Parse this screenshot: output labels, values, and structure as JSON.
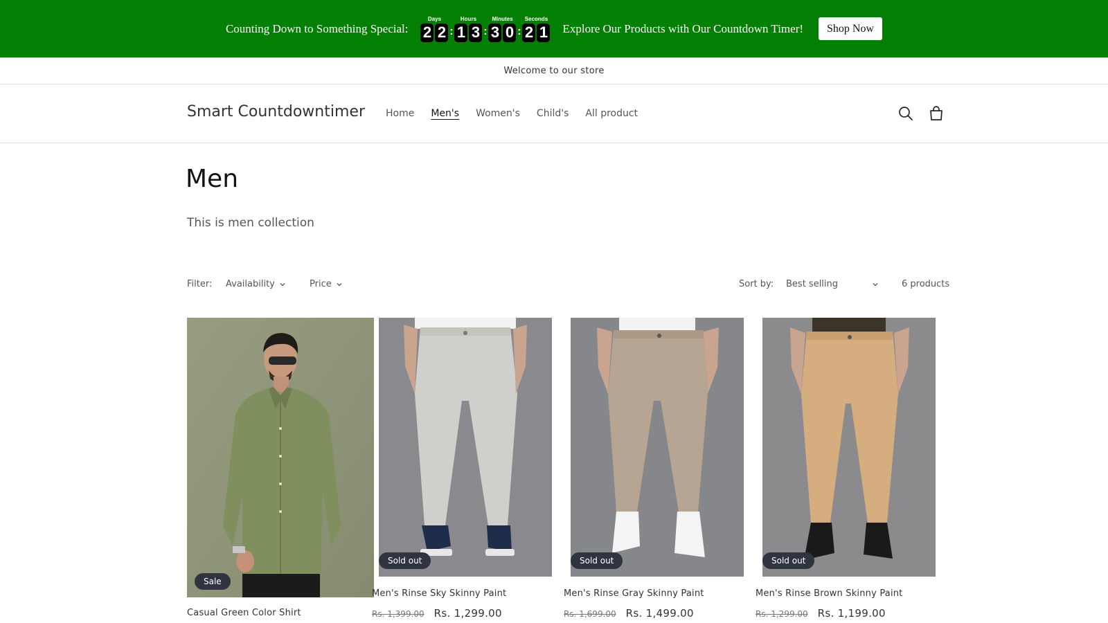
{
  "banner": {
    "left_text": "Counting Down to Something Special:",
    "right_text": "Explore Our Products with Our Countdown Timer!",
    "button": "Shop Now",
    "bg_color": "#038003",
    "timer": [
      {
        "label": "Days",
        "d1": "2",
        "d2": "2"
      },
      {
        "label": "Hours",
        "d1": "1",
        "d2": "3"
      },
      {
        "label": "Minutes",
        "d1": "3",
        "d2": "0"
      },
      {
        "label": "Seconds",
        "d1": "2",
        "d2": "1"
      }
    ]
  },
  "announcement": "Welcome to our store",
  "header": {
    "logo": "Smart Countdowntimer",
    "nav": [
      "Home",
      "Men's",
      "Women's",
      "Child's",
      "All product"
    ],
    "active_nav": "Men's",
    "icons": [
      "search-icon",
      "cart-icon"
    ]
  },
  "collection": {
    "title": "Men",
    "description": "This is men collection"
  },
  "filters": {
    "label": "Filter:",
    "availability": "Availability",
    "price": "Price",
    "sort_label": "Sort by:",
    "sort_value": "Best selling",
    "count": "6 products"
  },
  "products": [
    {
      "name": "Casual Green Color Shirt",
      "badge": "Sale",
      "compare_price": "",
      "price": ""
    },
    {
      "name": "Men's Rinse Sky Skinny Paint",
      "badge": "Sold out",
      "compare_price": "Rs. 1,399.00",
      "price": "Rs. 1,299.00"
    },
    {
      "name": "Men's Rinse Gray Skinny Paint",
      "badge": "Sold out",
      "compare_price": "Rs. 1,699.00",
      "price": "Rs. 1,499.00"
    },
    {
      "name": "Men's Rinse Brown Skinny Paint",
      "badge": "Sold out",
      "compare_price": "Rs. 1,299.00",
      "price": "Rs. 1,199.00"
    }
  ]
}
